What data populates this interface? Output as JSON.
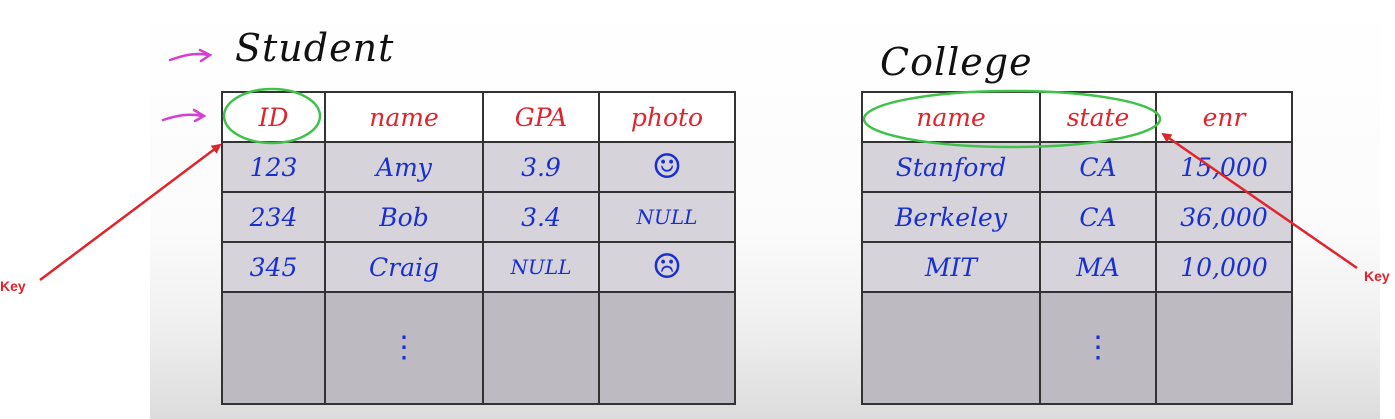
{
  "student": {
    "title": "Student",
    "headers": [
      "ID",
      "name",
      "GPA",
      "photo"
    ],
    "rows": [
      [
        "123",
        "Amy",
        "3.9",
        "☺"
      ],
      [
        "234",
        "Bob",
        "3.4",
        "NULL"
      ],
      [
        "345",
        "Craig",
        "NULL",
        "☹"
      ]
    ],
    "continuation": "⋮"
  },
  "college": {
    "title": "College",
    "headers": [
      "name",
      "state",
      "enr"
    ],
    "rows": [
      [
        "Stanford",
        "CA",
        "15,000"
      ],
      [
        "Berkeley",
        "CA",
        "36,000"
      ],
      [
        "MIT",
        "MA",
        "10,000"
      ]
    ],
    "continuation": "⋮"
  },
  "annotations": {
    "left_key_label": "Key",
    "right_key_label": "Key",
    "arrow_color": "#e0242c",
    "circle_color": "#3fc24a",
    "pointer_color": "#d43fd0"
  }
}
